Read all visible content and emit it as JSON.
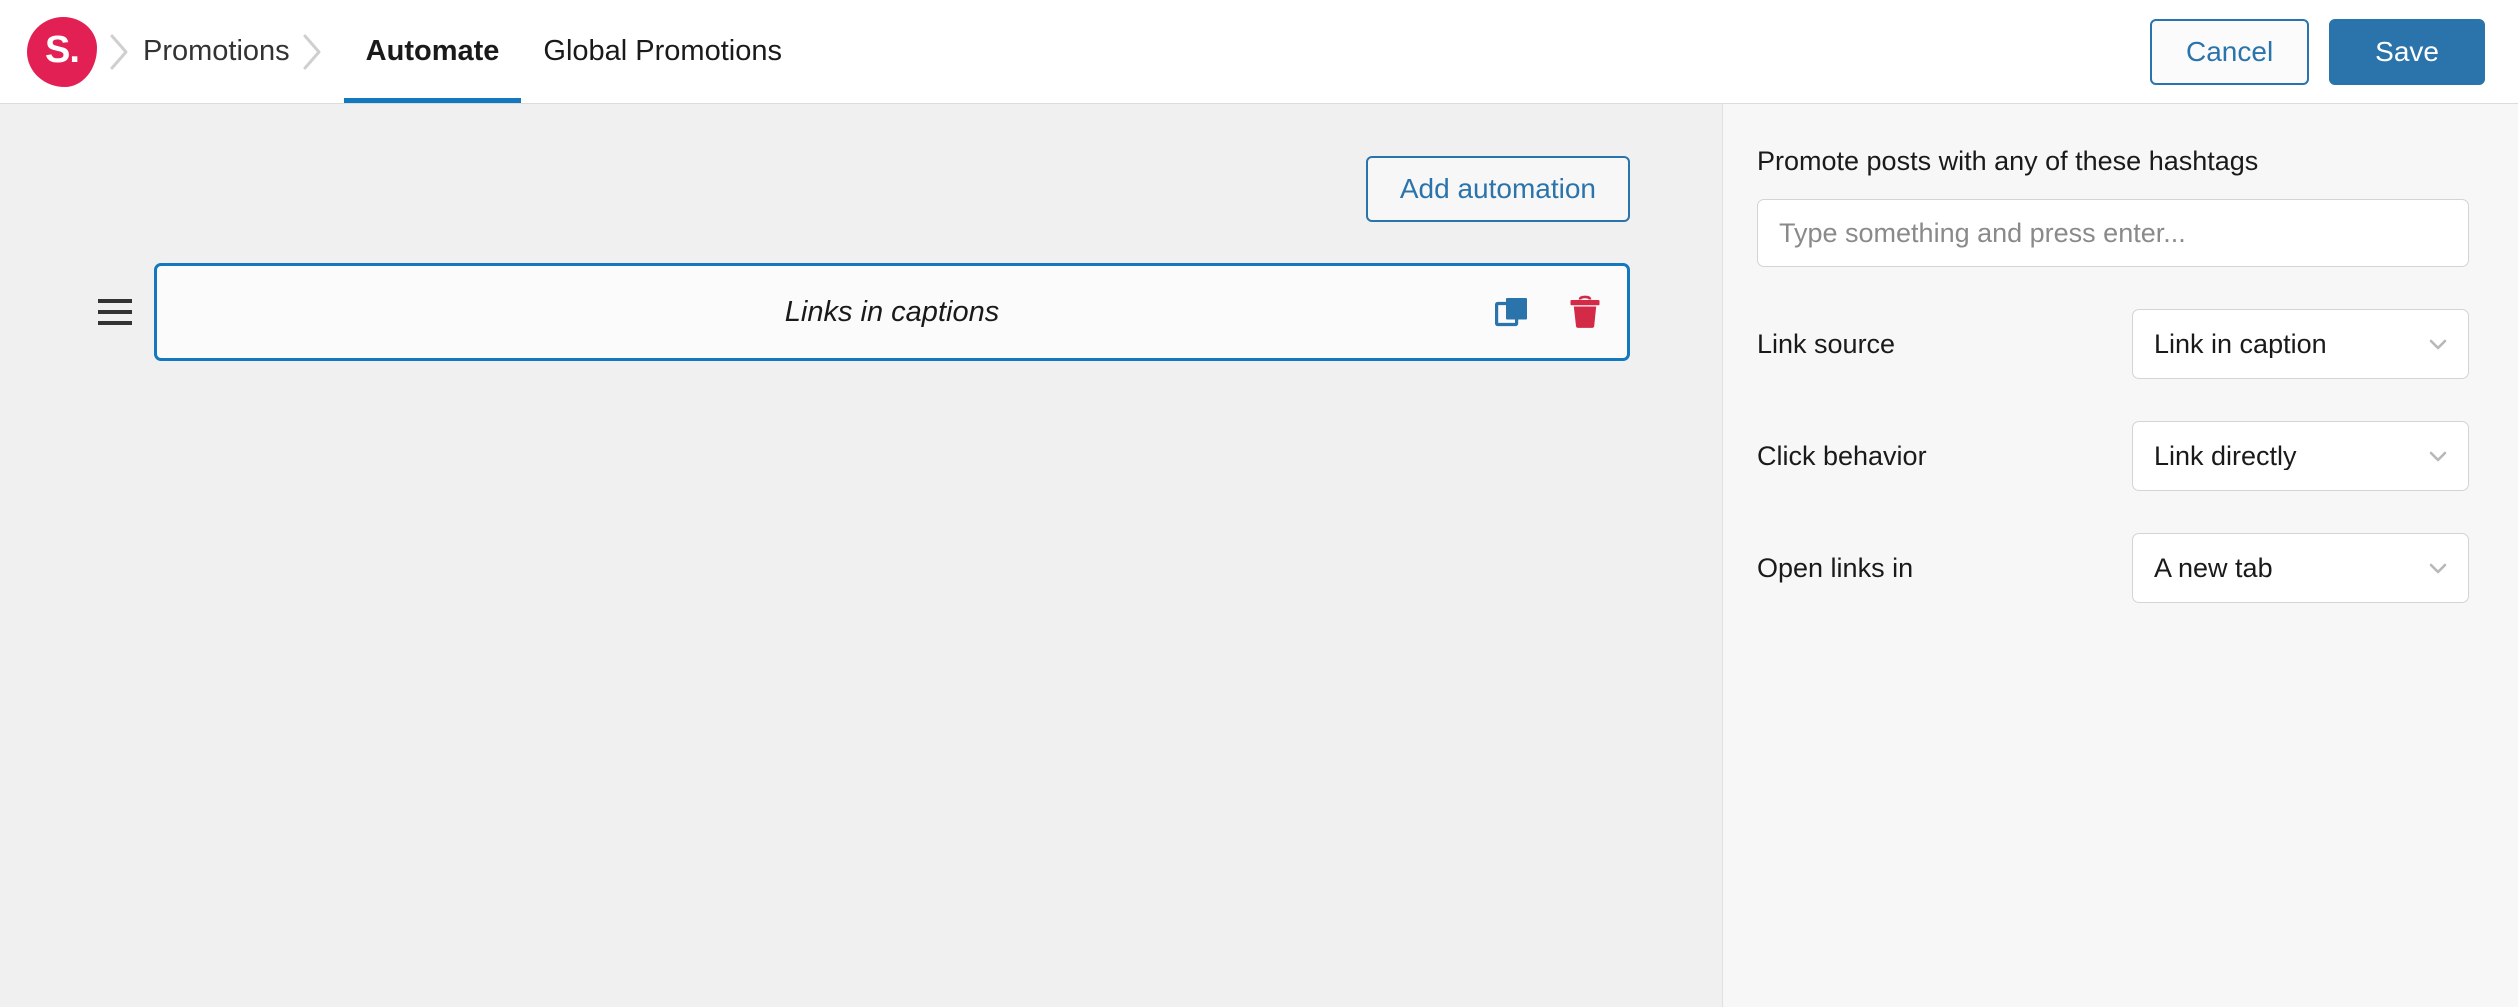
{
  "header": {
    "logo_text": "S.",
    "logo_color": "#e32053",
    "breadcrumb": [
      {
        "label": "Promotions"
      }
    ],
    "tabs": [
      {
        "label": "Automate",
        "active": true
      },
      {
        "label": "Global Promotions",
        "active": false
      }
    ],
    "cancel_label": "Cancel",
    "save_label": "Save",
    "accent_color": "#2a74ab",
    "active_tab_underline_color": "#1478be"
  },
  "canvas": {
    "add_automation_label": "Add automation",
    "automations": [
      {
        "title": "Links in captions",
        "selected": true,
        "duplicate_icon": "copy-icon",
        "delete_icon": "trash-icon",
        "drag_icon": "drag-handle-icon"
      }
    ],
    "selected_border_color": "#1478be",
    "duplicate_icon_color": "#2a74ab",
    "delete_icon_color": "#d32a47"
  },
  "panel": {
    "hashtags_label": "Promote posts with any of these hashtags",
    "hashtags_value": "",
    "hashtags_placeholder": "Type something and press enter...",
    "fields": [
      {
        "label": "Link source",
        "value": "Link in caption",
        "icon": "chevron-down-icon"
      },
      {
        "label": "Click behavior",
        "value": "Link directly",
        "icon": "chevron-down-icon"
      },
      {
        "label": "Open links in",
        "value": "A new tab",
        "icon": "chevron-down-icon"
      }
    ]
  }
}
